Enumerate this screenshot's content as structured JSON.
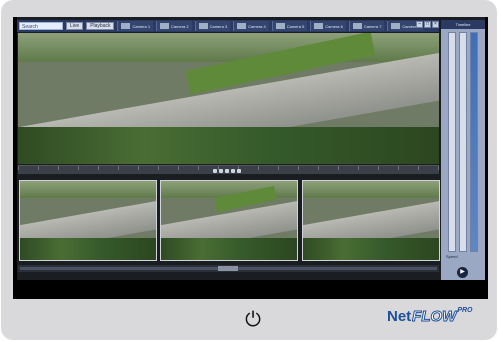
{
  "toolbar": {
    "search_placeholder": "Search",
    "button_a": "Live",
    "button_b": "Playback",
    "tabs": [
      {
        "label": "Camera 1"
      },
      {
        "label": "Camera 2"
      },
      {
        "label": "Camera 3"
      },
      {
        "label": "Camera 4"
      },
      {
        "label": "Camera 5"
      },
      {
        "label": "Camera 6"
      },
      {
        "label": "Camera 7"
      },
      {
        "label": "Camera 8"
      }
    ]
  },
  "right_panel": {
    "title": "Timeline",
    "label": "Speed"
  },
  "brand": {
    "net": "Net",
    "flow": "FLOW",
    "pro": "PRO"
  },
  "colors": {
    "bezel": "#d9d9db",
    "toolbar": "#2b3a63",
    "brand_blue": "#1e4f9a"
  },
  "icons": {
    "power": "power-icon",
    "play": "play-icon"
  }
}
